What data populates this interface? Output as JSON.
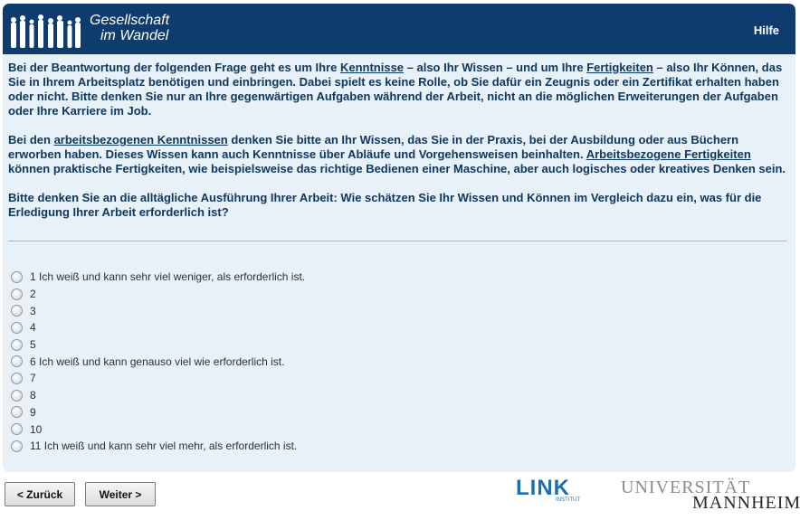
{
  "header": {
    "logo_line1": "Gesellschaft",
    "logo_line2": "im Wandel",
    "help_label": "Hilfe"
  },
  "intro": {
    "p1_a": "Bei der Beantwortung der folgenden Frage geht es um Ihre ",
    "p1_link1": "Kenntnisse",
    "p1_b": " – also Ihr Wissen – und um Ihre ",
    "p1_link2": "Fertigkeiten",
    "p1_c": " – also Ihr Können, das Sie in Ihrem Arbeitsplatz benötigen und einbringen. Dabei spielt es keine Rolle, ob Sie dafür ein Zeugnis oder ein Zertifikat erhalten haben oder nicht. Bitte denken Sie nur an Ihre gegenwärtigen Aufgaben während der Arbeit, nicht an die möglichen Erweiterungen der Aufgaben oder Ihre Karriere im Job.",
    "p2_a": "Bei den ",
    "p2_link1": "arbeitsbezogenen Kenntnissen",
    "p2_b": " denken Sie bitte an Ihr Wissen, das Sie in der Praxis, bei der Ausbildung oder aus Büchern erworben haben. Dieses Wissen kann auch Kenntnisse über Abläufe und Vorgehensweisen beinhalten. ",
    "p2_link2": "Arbeitsbezogene Fertigkeiten",
    "p2_c": " können praktische Fertigkeiten, wie beispielsweise das richtige Bedienen einer Maschine, aber auch logisches oder kreatives Denken sein.",
    "question": "Bitte denken Sie an die alltägliche Ausführung Ihrer Arbeit: Wie schätzen Sie Ihr Wissen und Können im Vergleich dazu ein, was für die Erledigung Ihrer Arbeit erforderlich ist?"
  },
  "options": [
    "1 Ich weiß und kann sehr viel weniger, als erforderlich ist.",
    "2",
    "3",
    "4",
    "5",
    "6 Ich weiß und kann genauso viel wie erforderlich ist.",
    "7",
    "8",
    "9",
    "10",
    "11 Ich weiß und kann sehr viel mehr, als erforderlich ist."
  ],
  "nav": {
    "back_label": "< Zurück",
    "next_label": "Weiter >"
  },
  "footer": {
    "link_logo": "LINK",
    "link_sub": "INSTITUT",
    "uni_line1": "UNIVERSITÄT",
    "uni_line2": "MANNHEIM"
  }
}
